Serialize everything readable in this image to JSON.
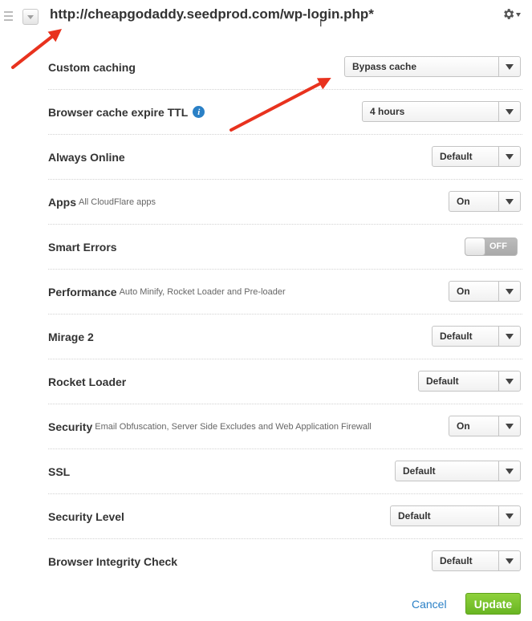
{
  "header": {
    "url": "http://cheapgodaddy.seedprod.com/wp-login.php*",
    "text_cursor": "I",
    "icons": {
      "drag": "drag-handle-icon",
      "collapse": "chevron-down-icon",
      "settings": "gear-icon"
    }
  },
  "settings": [
    {
      "label": "Custom caching",
      "description": "",
      "control": "select",
      "value": "Bypass cache"
    },
    {
      "label": "Browser cache expire TTL",
      "description": "",
      "info_icon": "i",
      "control": "select",
      "value": "4 hours"
    },
    {
      "label": "Always Online",
      "description": "",
      "control": "select",
      "value": "Default"
    },
    {
      "label": "Apps",
      "description": "All CloudFlare apps",
      "control": "select",
      "value": "On"
    },
    {
      "label": "Smart Errors",
      "description": "",
      "control": "toggle",
      "value": "OFF"
    },
    {
      "label": "Performance",
      "description": "Auto Minify, Rocket Loader and Pre-loader",
      "control": "select",
      "value": "On"
    },
    {
      "label": "Mirage 2",
      "description": "",
      "control": "select",
      "value": "Default"
    },
    {
      "label": "Rocket Loader",
      "description": "",
      "control": "select",
      "value": "Default"
    },
    {
      "label": "Security",
      "description": "Email Obfuscation, Server Side Excludes and Web Application Firewall",
      "control": "select",
      "value": "On"
    },
    {
      "label": "SSL",
      "description": "",
      "control": "select",
      "value": "Default"
    },
    {
      "label": "Security Level",
      "description": "",
      "control": "select",
      "value": "Default"
    },
    {
      "label": "Browser Integrity Check",
      "description": "",
      "control": "select",
      "value": "Default"
    }
  ],
  "footer": {
    "cancel_label": "Cancel",
    "update_label": "Update"
  },
  "colors": {
    "link": "#2a80c6",
    "update": "#7cc232",
    "annotation_arrow": "#e8321e"
  }
}
